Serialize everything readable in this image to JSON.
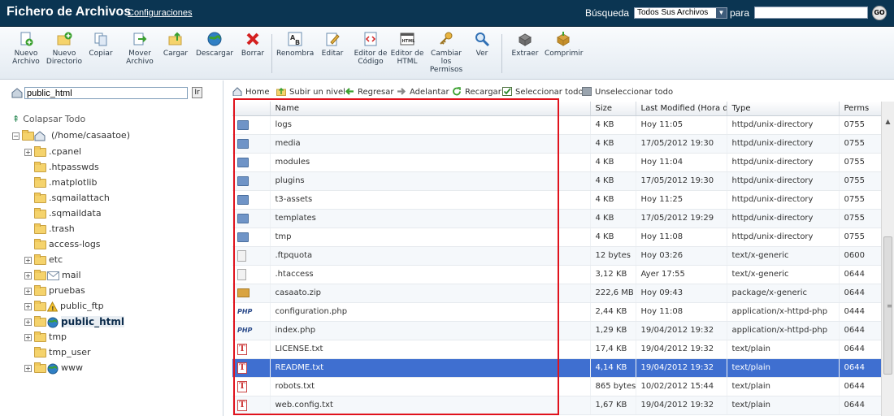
{
  "header": {
    "title": "Fichero de Archivos",
    "config_link": "Configuraciones",
    "search_label": "Búsqueda",
    "search_scope": "Todos Sus Archivos",
    "para_label": "para",
    "search_value": "",
    "go_label": "GO"
  },
  "toolbar": {
    "tools": [
      {
        "label": "Nuevo Archivo",
        "icon": "new-file-icon"
      },
      {
        "label": "Nuevo Directorio",
        "icon": "new-folder-icon"
      },
      {
        "label": "Copiar",
        "icon": "copy-icon"
      },
      {
        "label": "Mover Archivo",
        "icon": "move-icon"
      },
      {
        "label": "Cargar",
        "icon": "upload-icon"
      },
      {
        "label": "Descargar",
        "icon": "download-icon"
      },
      {
        "label": "Borrar",
        "icon": "delete-icon"
      },
      {
        "label": "Renombra",
        "icon": "rename-icon"
      },
      {
        "label": "Editar",
        "icon": "edit-icon"
      },
      {
        "label": "Editor de Código",
        "icon": "code-editor-icon"
      },
      {
        "label": "Editor de HTML",
        "icon": "html-editor-icon"
      },
      {
        "label": "Cambiar los Permisos",
        "icon": "permissions-icon"
      },
      {
        "label": "Ver",
        "icon": "view-icon"
      },
      {
        "label": "Extraer",
        "icon": "extract-icon"
      },
      {
        "label": "Comprimir",
        "icon": "compress-icon"
      }
    ]
  },
  "sidebar": {
    "path_value": "public_html",
    "collapse_all": "Colapsar Todo",
    "tree": [
      {
        "label": "(/home/casaatoe)"
      },
      {
        "label": ".cpanel"
      },
      {
        "label": ".htpasswds"
      },
      {
        "label": ".matplotlib"
      },
      {
        "label": ".sqmailattach"
      },
      {
        "label": ".sqmaildata"
      },
      {
        "label": ".trash"
      },
      {
        "label": "access-logs"
      },
      {
        "label": "etc"
      },
      {
        "label": "mail"
      },
      {
        "label": "pruebas"
      },
      {
        "label": "public_ftp"
      },
      {
        "label": "public_html"
      },
      {
        "label": "tmp"
      },
      {
        "label": "tmp_user"
      },
      {
        "label": "www"
      }
    ]
  },
  "nav": {
    "home": "Home",
    "up": "Subir un nivel",
    "back": "Regresar",
    "forward": "Adelantar",
    "reload": "Recargar",
    "select_all": "Seleccionar todo",
    "unselect_all": "Unseleccionar todo"
  },
  "table": {
    "columns": [
      "Name",
      "Size",
      "Last Modified (Hora de ve",
      "Type",
      "Perms"
    ],
    "rows": [
      {
        "icon": "folder-icon",
        "name": "logs",
        "size": "4 KB",
        "modified": "Hoy 11:05",
        "type": "httpd/unix-directory",
        "perms": "0755"
      },
      {
        "icon": "folder-icon",
        "name": "media",
        "size": "4 KB",
        "modified": "17/05/2012 19:30",
        "type": "httpd/unix-directory",
        "perms": "0755"
      },
      {
        "icon": "folder-icon",
        "name": "modules",
        "size": "4 KB",
        "modified": "Hoy 11:04",
        "type": "httpd/unix-directory",
        "perms": "0755"
      },
      {
        "icon": "folder-icon",
        "name": "plugins",
        "size": "4 KB",
        "modified": "17/05/2012 19:30",
        "type": "httpd/unix-directory",
        "perms": "0755"
      },
      {
        "icon": "folder-icon",
        "name": "t3-assets",
        "size": "4 KB",
        "modified": "Hoy 11:25",
        "type": "httpd/unix-directory",
        "perms": "0755"
      },
      {
        "icon": "folder-icon",
        "name": "templates",
        "size": "4 KB",
        "modified": "17/05/2012 19:29",
        "type": "httpd/unix-directory",
        "perms": "0755"
      },
      {
        "icon": "folder-icon",
        "name": "tmp",
        "size": "4 KB",
        "modified": "Hoy 11:08",
        "type": "httpd/unix-directory",
        "perms": "0755"
      },
      {
        "icon": "generic-file-icon",
        "name": ".ftpquota",
        "size": "12 bytes",
        "modified": "Hoy 03:26",
        "type": "text/x-generic",
        "perms": "0600"
      },
      {
        "icon": "generic-file-icon",
        "name": ".htaccess",
        "size": "3,12 KB",
        "modified": "Ayer 17:55",
        "type": "text/x-generic",
        "perms": "0644"
      },
      {
        "icon": "zip-file-icon",
        "name": "casaato.zip",
        "size": "222,6 MB",
        "modified": "Hoy 09:43",
        "type": "package/x-generic",
        "perms": "0644"
      },
      {
        "icon": "php-file-icon",
        "name": "configuration.php",
        "size": "2,44 KB",
        "modified": "Hoy 11:08",
        "type": "application/x-httpd-php",
        "perms": "0444"
      },
      {
        "icon": "php-file-icon",
        "name": "index.php",
        "size": "1,29 KB",
        "modified": "19/04/2012 19:32",
        "type": "application/x-httpd-php",
        "perms": "0644"
      },
      {
        "icon": "text-file-icon",
        "name": "LICENSE.txt",
        "size": "17,4 KB",
        "modified": "19/04/2012 19:32",
        "type": "text/plain",
        "perms": "0644"
      },
      {
        "icon": "text-file-icon",
        "name": "README.txt",
        "size": "4,14 KB",
        "modified": "19/04/2012 19:32",
        "type": "text/plain",
        "perms": "0644",
        "selected": true
      },
      {
        "icon": "text-file-icon",
        "name": "robots.txt",
        "size": "865 bytes",
        "modified": "10/02/2012 15:44",
        "type": "text/plain",
        "perms": "0644"
      },
      {
        "icon": "text-file-icon",
        "name": "web.config.txt",
        "size": "1,67 KB",
        "modified": "19/04/2012 19:32",
        "type": "text/plain",
        "perms": "0644"
      }
    ]
  },
  "colors": {
    "header_bg": "#0b3552",
    "selected_row": "#3f6fd0",
    "highlight_box": "#e0121c"
  }
}
